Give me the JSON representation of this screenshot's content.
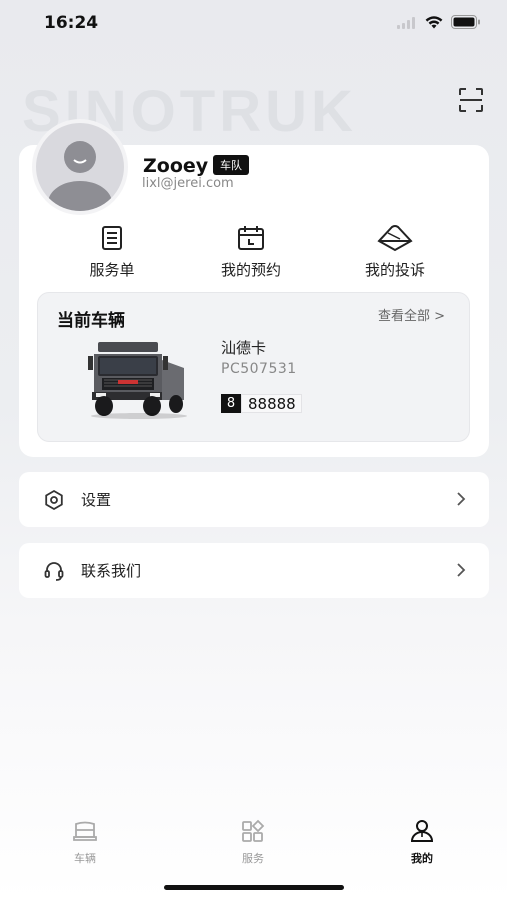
{
  "status_bar": {
    "time": "16:24"
  },
  "watermark": "SINOTRUK",
  "profile": {
    "name": "Zooey",
    "badge": "车队",
    "email": "lixl@jerei.com"
  },
  "quick_actions": [
    {
      "label": "服务单",
      "icon": "service-order-icon"
    },
    {
      "label": "我的预约",
      "icon": "calendar-icon"
    },
    {
      "label": "我的投诉",
      "icon": "complaint-icon"
    }
  ],
  "current_vehicle": {
    "title": "当前车辆",
    "view_all": "查看全部 >",
    "model": "汕德卡",
    "code": "PC507531",
    "plate_prefix": "8",
    "plate_number": "88888"
  },
  "menu": [
    {
      "label": "设置",
      "icon": "settings-icon"
    },
    {
      "label": "联系我们",
      "icon": "headset-icon"
    }
  ],
  "tabs": [
    {
      "label": "车辆",
      "icon": "vehicle-icon",
      "active": false
    },
    {
      "label": "服务",
      "icon": "service-grid-icon",
      "active": false
    },
    {
      "label": "我的",
      "icon": "profile-icon",
      "active": true
    }
  ]
}
